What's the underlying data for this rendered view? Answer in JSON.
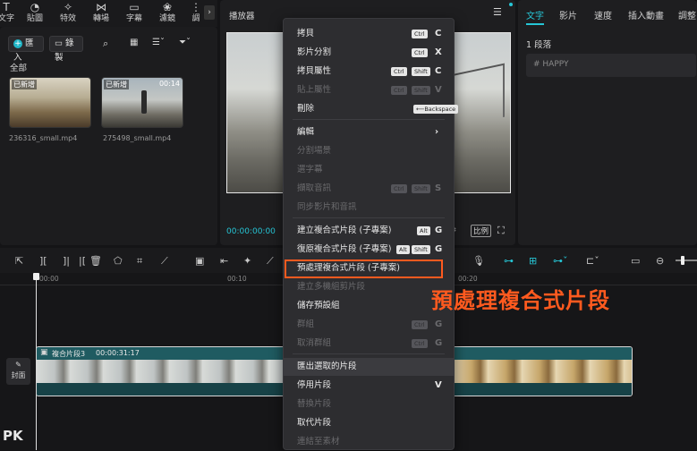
{
  "toolbar": {
    "items": [
      {
        "icon": "text-icon",
        "label": "文字"
      },
      {
        "icon": "sticker-icon",
        "label": "貼圖"
      },
      {
        "icon": "effects-icon",
        "label": "特效"
      },
      {
        "icon": "transition-icon",
        "label": "轉場"
      },
      {
        "icon": "caption-icon",
        "label": "字幕"
      },
      {
        "icon": "filter-icon",
        "label": "濾鏡"
      },
      {
        "icon": "more-icon",
        "label": "調"
      }
    ]
  },
  "media": {
    "import_label": "匯入",
    "record_label": "錄製",
    "section_label": "全部",
    "clips": [
      {
        "tag": "已新增",
        "name": "236316_small.mp4",
        "duration": ""
      },
      {
        "tag": "已新增",
        "name": "275498_small.mp4",
        "duration": "00:14"
      }
    ]
  },
  "player": {
    "title": "播放器",
    "timecode": "00:00:00:00",
    "ratio_label": "比例"
  },
  "context_menu": {
    "items": [
      {
        "label": "拷貝",
        "keys": [
          "Ctrl"
        ],
        "key": "C",
        "disabled": false
      },
      {
        "label": "影片分割",
        "keys": [
          "Ctrl"
        ],
        "key": "X",
        "disabled": false
      },
      {
        "label": "拷貝屬性",
        "keys": [
          "Ctrl",
          "Shift"
        ],
        "key": "C",
        "disabled": false
      },
      {
        "label": "貼上屬性",
        "keys": [
          "Ctrl",
          "Shift"
        ],
        "key": "V",
        "disabled": true
      },
      {
        "label": "刪除",
        "keys": [
          "⟵Backspace"
        ],
        "key": "",
        "disabled": false
      },
      {
        "label": "編輯",
        "keys": [],
        "key": "›",
        "disabled": false
      },
      {
        "label": "分割場景",
        "keys": [],
        "key": "",
        "disabled": true
      },
      {
        "label": "選字幕",
        "keys": [],
        "key": "",
        "disabled": true
      },
      {
        "label": "擷取音訊",
        "keys": [
          "Ctrl",
          "Shift"
        ],
        "key": "S",
        "disabled": true
      },
      {
        "label": "同步影片和音訊",
        "keys": [],
        "key": "",
        "disabled": true
      },
      {
        "label": "建立複合式片段 (子專案)",
        "keys": [
          "Alt"
        ],
        "key": "G",
        "disabled": false
      },
      {
        "label": "復原複合式片段 (子專案)",
        "keys": [
          "Alt",
          "Shift"
        ],
        "key": "G",
        "disabled": false
      },
      {
        "label": "預處理複合式片段 (子專案)",
        "keys": [],
        "key": "",
        "disabled": false
      },
      {
        "label": "建立多機組剪片段",
        "keys": [],
        "key": "",
        "disabled": true
      },
      {
        "label": "儲存預設組",
        "keys": [],
        "key": "",
        "disabled": false
      },
      {
        "label": "群組",
        "keys": [
          "Ctrl"
        ],
        "key": "G",
        "disabled": true
      },
      {
        "label": "取消群組",
        "keys": [
          "Ctrl"
        ],
        "key": "G",
        "disabled": true
      },
      {
        "label": "匯出選取的片段",
        "keys": [],
        "key": "",
        "disabled": false
      },
      {
        "label": "停用片段",
        "keys": [],
        "key": "V",
        "disabled": false
      },
      {
        "label": "替換片段",
        "keys": [],
        "key": "",
        "disabled": true
      },
      {
        "label": "取代片段",
        "keys": [],
        "key": "",
        "disabled": false
      },
      {
        "label": "連結至素材",
        "keys": [],
        "key": "",
        "disabled": true
      }
    ]
  },
  "annotation": {
    "text": "預處理複合式片段"
  },
  "right_panel": {
    "tabs": [
      "文字",
      "影片",
      "速度",
      "插入動畫",
      "調整"
    ],
    "section_label": "1 段落",
    "hashtag": "# HAPPY"
  },
  "timeline": {
    "time_marks": [
      "00:00",
      "00:10",
      "00:20"
    ],
    "clip_label": "複合片段3",
    "clip_duration": "00:00:31:17",
    "cover_label": "封面"
  },
  "watermark": {
    "text": "PK"
  },
  "colors": {
    "accent": "#26c6d6",
    "highlight": "#ff5a1f",
    "import": "#21b6c7"
  }
}
